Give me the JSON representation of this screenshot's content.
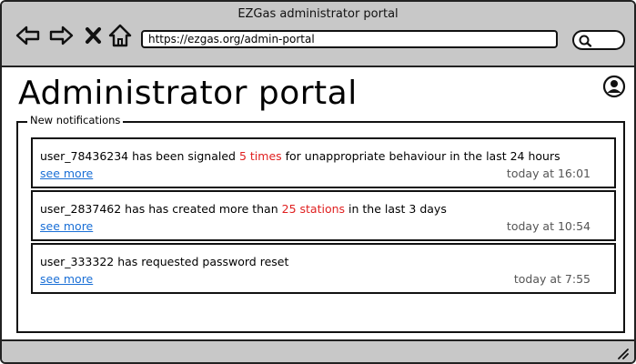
{
  "window": {
    "title": "EZGas administrator portal"
  },
  "toolbar": {
    "back_icon": "arrow-left-icon",
    "forward_icon": "arrow-right-icon",
    "stop_icon": "close-icon",
    "home_icon": "home-icon",
    "url": "https://ezgas.org/admin-portal",
    "search_icon": "search-icon"
  },
  "main": {
    "title": "Administrator portal",
    "user_icon": "user-icon",
    "panel_title": "New notifications",
    "notifications": [
      {
        "parts": [
          "user_78436234 has been signaled ",
          "5 times",
          " for unappropriate behaviour in the last 24 hours"
        ],
        "link": "see more",
        "time": "today at 16:01"
      },
      {
        "parts": [
          "user_2837462 has has created more than ",
          "25 stations",
          " in the last 3 days"
        ],
        "link": "see more",
        "time": "today at 10:54"
      },
      {
        "parts": [
          "user_333322 has requested password reset",
          "",
          ""
        ],
        "link": "see more",
        "time": "today at 7:55"
      }
    ]
  },
  "colors": {
    "chrome": "#c8c8c8",
    "highlight": "#e02020",
    "link": "#1a6fd6"
  }
}
